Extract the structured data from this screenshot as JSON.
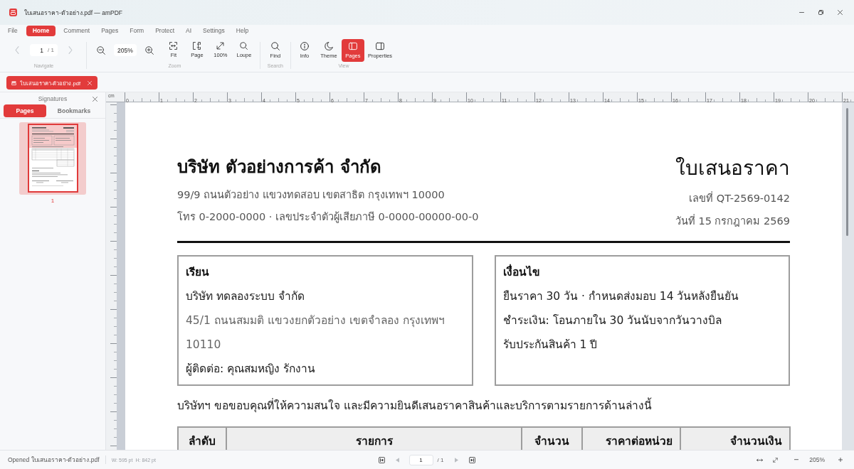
{
  "window": {
    "title": "ใบเสนอราคา-ตัวอย่าง.pdf — amPDF"
  },
  "menu": [
    {
      "label": "File",
      "selected": false
    },
    {
      "label": "Home",
      "selected": true
    },
    {
      "label": "Comment",
      "selected": false
    },
    {
      "label": "Pages",
      "selected": false
    },
    {
      "label": "Form",
      "selected": false
    },
    {
      "label": "Protect",
      "selected": false
    },
    {
      "label": "AI",
      "selected": false
    },
    {
      "label": "Settings",
      "selected": false
    },
    {
      "label": "Help",
      "selected": false
    }
  ],
  "toolbar": {
    "navigate": {
      "label": "Navigate",
      "previous": {
        "disabled": true
      },
      "page": "1",
      "total": "/ 1",
      "next": {
        "disabled": true
      }
    },
    "zoom": {
      "label": "Zoom",
      "value": "205%",
      "buttons": [
        {
          "label": "Fit"
        },
        {
          "label": "Page"
        },
        {
          "label": "100%"
        },
        {
          "label": "Loupe"
        }
      ]
    },
    "search": {
      "label": "Search",
      "buttons": [
        {
          "label": "Find"
        }
      ]
    },
    "view": {
      "label": "View",
      "buttons": [
        {
          "label": "Info",
          "selected": false
        },
        {
          "label": "Theme",
          "selected": false
        },
        {
          "label": "Pages",
          "selected": true
        },
        {
          "label": "Properties",
          "selected": false
        }
      ]
    }
  },
  "document_tabs": [
    {
      "label": "ใบเสนอราคา-ตัวอย่าง.pdf",
      "selected": true
    }
  ],
  "sidebar": {
    "title": "Signatures",
    "tabs": [
      {
        "label": "Pages",
        "selected": true
      },
      {
        "label": "Bookmarks",
        "selected": false
      }
    ],
    "thumbnails": [
      {
        "label": "1",
        "selected": true
      }
    ]
  },
  "ruler": {
    "unit": "cm",
    "labels": [
      "0",
      "1",
      "2",
      "3",
      "4",
      "5",
      "6",
      "7",
      "8",
      "9",
      "10",
      "11",
      "12",
      "13",
      "14",
      "15",
      "16",
      "17",
      "18",
      "19",
      "20",
      "21"
    ]
  },
  "document": {
    "company": "บริษัท ตัวอย่างการค้า จำกัด",
    "address": "99/9 ถนนตัวอย่าง แขวงทดสอบ เขตสาธิต กรุงเทพฯ 10000",
    "contact": "โทร 0-2000-0000 · เลขประจำตัวผู้เสียภาษี 0-0000-00000-00-0",
    "title": "ใบเสนอราคา",
    "number": "เลขที่ QT-2569-0142",
    "date": "วันที่ 15 กรกฎาคม 2569",
    "boxes": [
      {
        "heading": "เรียน",
        "lines": [
          {
            "text": "บริษัท ทดลองระบบ จำกัด",
            "kind": "primary"
          },
          {
            "text": "45/1 ถนนสมมติ แขวงยกตัวอย่าง เขตจำลอง กรุงเทพฯ 10110",
            "kind": "secondary"
          },
          {
            "text": "ผู้ติดต่อ: คุณสมหญิง รักงาน",
            "kind": "primary"
          }
        ]
      },
      {
        "heading": "เงื่อนไข",
        "lines": [
          {
            "text": "ยืนราคา 30 วัน · กำหนดส่งมอบ 14 วันหลังยืนยัน",
            "kind": "primary"
          },
          {
            "text": "ชำระเงิน: โอนภายใน 30 วันนับจากวันวางบิล",
            "kind": "primary"
          },
          {
            "text": "รับประกันสินค้า 1 ปี",
            "kind": "primary"
          }
        ]
      }
    ],
    "intro": "บริษัทฯ ขอขอบคุณที่ให้ความสนใจ และมีความยินดีเสนอราคาสินค้าและบริการตามรายการด้านล่างนี้",
    "table": {
      "columns": [
        "ลำดับ",
        "รายการ",
        "จำนวน",
        "ราคาต่อหน่วย",
        "จำนวนเงิน"
      ]
    }
  },
  "status_bar": {
    "message": "Opened ใบเสนอราคา-ตัวอย่าง.pdf",
    "width": "W: 595 pt",
    "height": "H: 842 pt",
    "pager": {
      "first": {
        "disabled": false
      },
      "previous": {
        "disabled": true
      },
      "page": "1",
      "total": "/ 1",
      "next": {
        "disabled": true
      },
      "last": {
        "disabled": false
      }
    },
    "zoom": "205%"
  }
}
